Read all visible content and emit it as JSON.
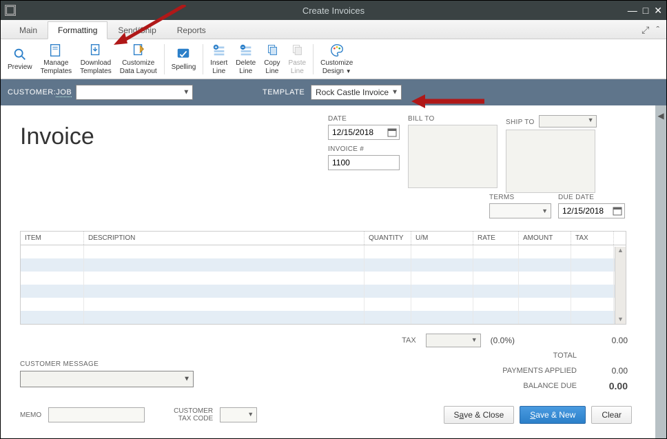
{
  "window": {
    "title": "Create Invoices"
  },
  "tabs": {
    "main": "Main",
    "formatting": "Formatting",
    "sendship": "Send/Ship",
    "reports": "Reports"
  },
  "ribbon": {
    "preview": "Preview",
    "manage_tpl1": "Manage",
    "manage_tpl2": "Templates",
    "download_tpl1": "Download",
    "download_tpl2": "Templates",
    "customize_dl1": "Customize",
    "customize_dl2": "Data Layout",
    "spelling": "Spelling",
    "insert_line1": "Insert",
    "insert_line2": "Line",
    "delete_line1": "Delete",
    "delete_line2": "Line",
    "copy_line1": "Copy",
    "copy_line2": "Line",
    "paste_line1": "Paste",
    "paste_line2": "Line",
    "customize_design1": "Customize",
    "customize_design2": "Design"
  },
  "custbar": {
    "customer_job": "CUSTOMER:",
    "job": "JOB",
    "template": "TEMPLATE",
    "template_value": "Rock Castle Invoice"
  },
  "heading": "Invoice",
  "fields": {
    "date_label": "DATE",
    "date_value": "12/15/2018",
    "invoice_label": "INVOICE #",
    "invoice_value": "1100",
    "billto_label": "BILL TO",
    "shipto_label": "SHIP TO",
    "terms_label": "TERMS",
    "terms_value": "",
    "duedate_label": "DUE DATE",
    "duedate_value": "12/15/2018"
  },
  "cols": {
    "item": "ITEM",
    "desc": "DESCRIPTION",
    "qty": "QUANTITY",
    "um": "U/M",
    "rate": "RATE",
    "amount": "AMOUNT",
    "tax": "TAX"
  },
  "totals": {
    "tax_label": "TAX",
    "tax_pct": "(0.0%)",
    "tax_amt": "0.00",
    "total_label": "TOTAL",
    "total_amt": "",
    "payments_label": "PAYMENTS APPLIED",
    "payments_amt": "0.00",
    "balance_label": "BALANCE DUE",
    "balance_amt": "0.00"
  },
  "custmsg_label": "CUSTOMER MESSAGE",
  "memo_label": "MEMO",
  "taxcode_label1": "CUSTOMER",
  "taxcode_label2": "TAX CODE",
  "buttons": {
    "save_close": "Save & Close",
    "save_new": "Save & New",
    "clear": "Clear"
  }
}
